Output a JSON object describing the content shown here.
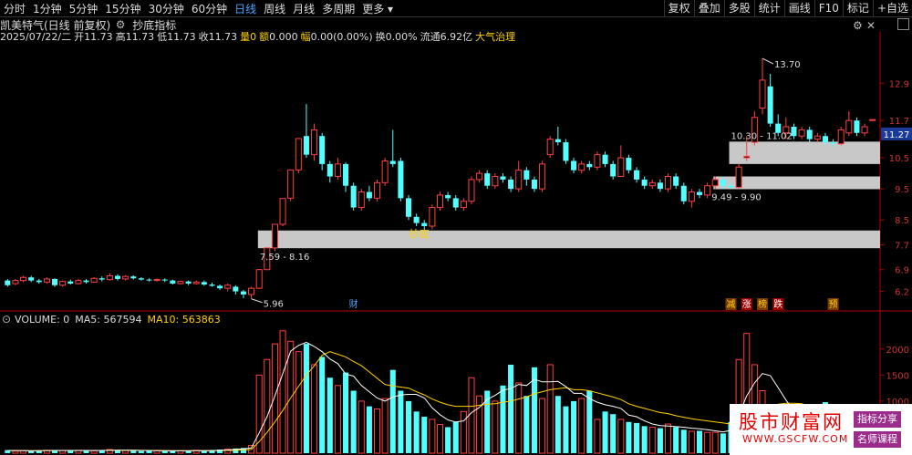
{
  "toolbar": {
    "tabs": [
      "分时",
      "1分钟",
      "5分钟",
      "15分钟",
      "30分钟",
      "60分钟",
      "日线",
      "周线",
      "月线",
      "多周期",
      "更多"
    ],
    "active_tab": "日线",
    "right_buttons": [
      "复权",
      "叠加",
      "多股",
      "统计",
      "画线",
      "F10",
      "标记",
      "+自选"
    ],
    "more_label": "更多"
  },
  "header": {
    "stock_name": "凯美特气(日线 前复权)",
    "indicator_name": "抄底指标"
  },
  "info": {
    "date": "2025/07/22/二",
    "open_label": "开",
    "open": "11.73",
    "high_label": "高",
    "high": "11.73",
    "low_label": "低",
    "low": "11.73",
    "close_label": "收",
    "close": "11.73",
    "vol_label": "量",
    "vol": "0",
    "amount_label": "额",
    "amount": "0.000",
    "range_label": "幅",
    "range": "0.00(0.00%)",
    "turnover_label": "换",
    "turnover": "0.00%",
    "float_label": "流通",
    "float": "6.92亿",
    "concept": "大气治理"
  },
  "volume_header": {
    "vol": "VOLUME: 0",
    "ma5": "MA5: 567594",
    "ma10": "MA10: 563863"
  },
  "colors": {
    "up": "#ff4040",
    "down": "#54ffff",
    "ma5": "#ffffff",
    "ma10": "#ffd200",
    "band": "#c8c8c8",
    "axis": "#b40000"
  },
  "chart_data": [
    {
      "type": "candlestick",
      "price_axis_ticks": [
        "12.9",
        "11.7",
        "10.5",
        "9.5",
        "8.5",
        "7.7",
        "6.9",
        "6.2"
      ],
      "ylim": [
        5.6,
        14.2
      ],
      "last_price_tag": "11.27",
      "annotations": {
        "high_marker": "13.70",
        "low_marker": "5.96",
        "bands": [
          {
            "label": "7.59 - 8.16",
            "low": 7.59,
            "high": 8.16
          },
          {
            "label": "9.49 - 9.90",
            "low": 9.49,
            "high": 9.9
          },
          {
            "label": "10.30 - 11.02",
            "low": 10.3,
            "high": 11.02
          }
        ],
        "signal_text": "抄底",
        "markers": [
          "财",
          "减",
          "涨",
          "榜",
          "跌",
          "预"
        ]
      },
      "candles": [
        {
          "o": 6.55,
          "c": 6.4,
          "h": 6.6,
          "l": 6.35
        },
        {
          "o": 6.45,
          "c": 6.55,
          "h": 6.6,
          "l": 6.4
        },
        {
          "o": 6.55,
          "c": 6.65,
          "h": 6.7,
          "l": 6.5
        },
        {
          "o": 6.65,
          "c": 6.55,
          "h": 6.7,
          "l": 6.5
        },
        {
          "o": 6.55,
          "c": 6.5,
          "h": 6.6,
          "l": 6.45
        },
        {
          "o": 6.5,
          "c": 6.6,
          "h": 6.65,
          "l": 6.45
        },
        {
          "o": 6.6,
          "c": 6.4,
          "h": 6.62,
          "l": 6.35
        },
        {
          "o": 6.4,
          "c": 6.52,
          "h": 6.55,
          "l": 6.35
        },
        {
          "o": 6.52,
          "c": 6.45,
          "h": 6.58,
          "l": 6.42
        },
        {
          "o": 6.45,
          "c": 6.55,
          "h": 6.6,
          "l": 6.42
        },
        {
          "o": 6.55,
          "c": 6.5,
          "h": 6.6,
          "l": 6.45
        },
        {
          "o": 6.5,
          "c": 6.62,
          "h": 6.66,
          "l": 6.48
        },
        {
          "o": 6.62,
          "c": 6.58,
          "h": 6.68,
          "l": 6.52
        },
        {
          "o": 6.58,
          "c": 6.7,
          "h": 6.78,
          "l": 6.55
        },
        {
          "o": 6.7,
          "c": 6.6,
          "h": 6.75,
          "l": 6.55
        },
        {
          "o": 6.6,
          "c": 6.68,
          "h": 6.72,
          "l": 6.55
        },
        {
          "o": 6.68,
          "c": 6.62,
          "h": 6.72,
          "l": 6.58
        },
        {
          "o": 6.62,
          "c": 6.58,
          "h": 6.66,
          "l": 6.55
        },
        {
          "o": 6.58,
          "c": 6.56,
          "h": 6.62,
          "l": 6.52
        },
        {
          "o": 6.56,
          "c": 6.58,
          "h": 6.62,
          "l": 6.52
        },
        {
          "o": 6.58,
          "c": 6.55,
          "h": 6.62,
          "l": 6.5
        },
        {
          "o": 6.55,
          "c": 6.45,
          "h": 6.58,
          "l": 6.42
        },
        {
          "o": 6.45,
          "c": 6.52,
          "h": 6.55,
          "l": 6.42
        },
        {
          "o": 6.52,
          "c": 6.45,
          "h": 6.55,
          "l": 6.4
        },
        {
          "o": 6.45,
          "c": 6.5,
          "h": 6.55,
          "l": 6.42
        },
        {
          "o": 6.5,
          "c": 6.42,
          "h": 6.55,
          "l": 6.38
        },
        {
          "o": 6.42,
          "c": 6.38,
          "h": 6.48,
          "l": 6.35
        },
        {
          "o": 6.38,
          "c": 6.3,
          "h": 6.42,
          "l": 6.25
        },
        {
          "o": 6.3,
          "c": 6.4,
          "h": 6.45,
          "l": 6.2
        },
        {
          "o": 6.35,
          "c": 6.2,
          "h": 6.4,
          "l": 6.1
        },
        {
          "o": 6.2,
          "c": 6.1,
          "h": 6.25,
          "l": 5.98
        },
        {
          "o": 6.1,
          "c": 6.3,
          "h": 6.35,
          "l": 5.96
        },
        {
          "o": 6.3,
          "c": 6.9,
          "h": 6.92,
          "l": 6.28
        },
        {
          "o": 6.9,
          "c": 7.6,
          "h": 7.6,
          "l": 6.9
        },
        {
          "o": 7.6,
          "c": 8.36,
          "h": 8.36,
          "l": 7.5
        },
        {
          "o": 8.36,
          "c": 9.19,
          "h": 9.19,
          "l": 8.3
        },
        {
          "o": 9.2,
          "c": 10.11,
          "h": 10.11,
          "l": 9.1
        },
        {
          "o": 10.11,
          "c": 11.12,
          "h": 11.12,
          "l": 10.0
        },
        {
          "o": 11.2,
          "c": 10.6,
          "h": 12.23,
          "l": 10.5
        },
        {
          "o": 10.6,
          "c": 11.4,
          "h": 11.6,
          "l": 10.4
        },
        {
          "o": 11.2,
          "c": 10.3,
          "h": 11.3,
          "l": 10.1
        },
        {
          "o": 10.3,
          "c": 9.9,
          "h": 10.4,
          "l": 9.7
        },
        {
          "o": 9.9,
          "c": 10.3,
          "h": 10.5,
          "l": 9.8
        },
        {
          "o": 10.3,
          "c": 9.6,
          "h": 10.35,
          "l": 9.4
        },
        {
          "o": 9.6,
          "c": 8.9,
          "h": 9.7,
          "l": 8.8
        },
        {
          "o": 8.9,
          "c": 9.4,
          "h": 9.5,
          "l": 8.8
        },
        {
          "o": 9.4,
          "c": 9.2,
          "h": 9.6,
          "l": 9.1
        },
        {
          "o": 9.2,
          "c": 9.7,
          "h": 9.8,
          "l": 9.1
        },
        {
          "o": 9.7,
          "c": 10.4,
          "h": 10.5,
          "l": 9.6
        },
        {
          "o": 10.4,
          "c": 10.3,
          "h": 11.4,
          "l": 10.2
        },
        {
          "o": 10.4,
          "c": 9.2,
          "h": 10.5,
          "l": 9.1
        },
        {
          "o": 9.2,
          "c": 8.6,
          "h": 9.3,
          "l": 8.5
        },
        {
          "o": 8.6,
          "c": 8.4,
          "h": 8.7,
          "l": 8.3
        },
        {
          "o": 8.4,
          "c": 8.3,
          "h": 8.5,
          "l": 8.2
        },
        {
          "o": 8.3,
          "c": 8.9,
          "h": 9.0,
          "l": 8.2
        },
        {
          "o": 8.9,
          "c": 9.3,
          "h": 9.4,
          "l": 8.8
        },
        {
          "o": 9.3,
          "c": 9.2,
          "h": 9.4,
          "l": 9.1
        },
        {
          "o": 9.2,
          "c": 8.9,
          "h": 9.3,
          "l": 8.8
        },
        {
          "o": 8.9,
          "c": 9.1,
          "h": 9.2,
          "l": 8.8
        },
        {
          "o": 9.1,
          "c": 9.8,
          "h": 9.9,
          "l": 9.0
        },
        {
          "o": 9.8,
          "c": 10.0,
          "h": 10.1,
          "l": 9.7
        },
        {
          "o": 10.0,
          "c": 9.6,
          "h": 10.1,
          "l": 9.5
        },
        {
          "o": 9.6,
          "c": 9.9,
          "h": 10.0,
          "l": 9.5
        },
        {
          "o": 9.9,
          "c": 9.8,
          "h": 10.0,
          "l": 9.7
        },
        {
          "o": 9.8,
          "c": 9.5,
          "h": 9.9,
          "l": 9.4
        },
        {
          "o": 9.5,
          "c": 10.1,
          "h": 10.4,
          "l": 9.4
        },
        {
          "o": 10.1,
          "c": 9.8,
          "h": 10.2,
          "l": 9.6
        },
        {
          "o": 9.8,
          "c": 9.5,
          "h": 9.9,
          "l": 9.4
        },
        {
          "o": 9.5,
          "c": 10.3,
          "h": 10.4,
          "l": 9.4
        },
        {
          "o": 10.6,
          "c": 11.1,
          "h": 11.2,
          "l": 10.5
        },
        {
          "o": 11.1,
          "c": 11.0,
          "h": 11.5,
          "l": 10.9
        },
        {
          "o": 11.0,
          "c": 10.4,
          "h": 11.1,
          "l": 10.3
        },
        {
          "o": 10.4,
          "c": 10.1,
          "h": 10.5,
          "l": 10.0
        },
        {
          "o": 10.1,
          "c": 10.3,
          "h": 10.4,
          "l": 10.0
        },
        {
          "o": 10.3,
          "c": 10.2,
          "h": 10.4,
          "l": 10.1
        },
        {
          "o": 10.2,
          "c": 10.6,
          "h": 10.7,
          "l": 10.1
        },
        {
          "o": 10.6,
          "c": 10.3,
          "h": 10.7,
          "l": 10.2
        },
        {
          "o": 10.3,
          "c": 9.9,
          "h": 10.4,
          "l": 9.8
        },
        {
          "o": 9.9,
          "c": 10.5,
          "h": 10.9,
          "l": 9.9
        },
        {
          "o": 10.5,
          "c": 10.1,
          "h": 10.6,
          "l": 10.0
        },
        {
          "o": 10.1,
          "c": 9.8,
          "h": 10.2,
          "l": 9.7
        },
        {
          "o": 9.8,
          "c": 9.6,
          "h": 9.9,
          "l": 9.5
        },
        {
          "o": 9.6,
          "c": 9.7,
          "h": 9.8,
          "l": 9.5
        },
        {
          "o": 9.7,
          "c": 9.5,
          "h": 9.8,
          "l": 9.4
        },
        {
          "o": 9.5,
          "c": 9.9,
          "h": 10.0,
          "l": 9.4
        },
        {
          "o": 9.9,
          "c": 9.6,
          "h": 10.0,
          "l": 9.5
        },
        {
          "o": 9.6,
          "c": 9.1,
          "h": 9.7,
          "l": 9.0
        },
        {
          "o": 9.1,
          "c": 9.4,
          "h": 9.5,
          "l": 8.9
        },
        {
          "o": 9.4,
          "c": 9.3,
          "h": 9.5,
          "l": 9.2
        },
        {
          "o": 9.3,
          "c": 9.6,
          "h": 9.7,
          "l": 9.2
        },
        {
          "o": 9.6,
          "c": 9.8,
          "h": 9.9,
          "l": 9.5
        },
        {
          "o": 9.8,
          "c": 9.6,
          "h": 9.9,
          "l": 9.49
        },
        {
          "o": 9.6,
          "c": 9.55,
          "h": 9.7,
          "l": 9.49
        },
        {
          "o": 9.55,
          "c": 10.2,
          "h": 10.3,
          "l": 9.5
        },
        {
          "o": 10.5,
          "c": 10.55,
          "h": 11.2,
          "l": 10.4
        },
        {
          "o": 11.0,
          "c": 11.8,
          "h": 12.0,
          "l": 10.9
        },
        {
          "o": 12.1,
          "c": 13.0,
          "h": 13.7,
          "l": 11.9
        },
        {
          "o": 12.8,
          "c": 11.6,
          "h": 13.2,
          "l": 11.5
        },
        {
          "o": 11.6,
          "c": 11.3,
          "h": 11.9,
          "l": 11.2
        },
        {
          "o": 11.3,
          "c": 11.5,
          "h": 11.8,
          "l": 11.1
        },
        {
          "o": 11.5,
          "c": 11.2,
          "h": 11.6,
          "l": 11.1
        },
        {
          "o": 11.2,
          "c": 11.4,
          "h": 11.5,
          "l": 11.1
        },
        {
          "o": 11.4,
          "c": 11.1,
          "h": 11.5,
          "l": 11.0
        },
        {
          "o": 11.1,
          "c": 11.2,
          "h": 11.3,
          "l": 11.0
        },
        {
          "o": 11.2,
          "c": 11.0,
          "h": 11.3,
          "l": 10.9
        },
        {
          "o": 11.0,
          "c": 10.95,
          "h": 11.1,
          "l": 10.85
        },
        {
          "o": 10.95,
          "c": 11.4,
          "h": 11.5,
          "l": 10.9
        },
        {
          "o": 11.3,
          "c": 11.7,
          "h": 12.0,
          "l": 11.2
        },
        {
          "o": 11.7,
          "c": 11.3,
          "h": 11.8,
          "l": 11.2
        },
        {
          "o": 11.3,
          "c": 11.5,
          "h": 11.6,
          "l": 11.2
        },
        {
          "o": 11.73,
          "c": 11.73,
          "h": 11.73,
          "l": 11.73
        }
      ]
    },
    {
      "type": "bar",
      "title": "VOLUME",
      "axis_ticks": [
        "2000",
        "1500",
        "1000"
      ],
      "ylim": [
        0,
        2400
      ],
      "values": [
        60,
        40,
        50,
        45,
        40,
        55,
        60,
        50,
        45,
        55,
        50,
        45,
        60,
        70,
        55,
        50,
        45,
        40,
        50,
        45,
        40,
        50,
        45,
        40,
        55,
        50,
        60,
        70,
        80,
        90,
        100,
        150,
        1500,
        1800,
        2100,
        2350,
        2150,
        1950,
        2100,
        1700,
        1850,
        1450,
        1300,
        1550,
        1200,
        1000,
        900,
        850,
        1050,
        1600,
        1200,
        1000,
        800,
        700,
        650,
        550,
        500,
        600,
        800,
        1450,
        1100,
        1200,
        1000,
        1300,
        1700,
        1350,
        1100,
        1650,
        1050,
        1700,
        1100,
        900,
        1000,
        1050,
        1200,
        650,
        800,
        750,
        650,
        600,
        580,
        520,
        500,
        480,
        560,
        500,
        450,
        420,
        430,
        400,
        400,
        380,
        600,
        1800,
        2300,
        1700,
        1200,
        600,
        500,
        350,
        450,
        250,
        220,
        300,
        980,
        500,
        400,
        350,
        0
      ],
      "ma5": [
        50,
        50,
        48,
        46,
        47,
        50,
        52,
        53,
        53,
        53,
        52,
        52,
        53,
        56,
        58,
        58,
        56,
        52,
        50,
        48,
        46,
        46,
        46,
        46,
        47,
        47,
        50,
        55,
        62,
        72,
        82,
        100,
        390,
        700,
        1100,
        1530,
        1960,
        2070,
        2130,
        2050,
        1950,
        1810,
        1720,
        1520,
        1480,
        1300,
        1180,
        1060,
        1000,
        1080,
        1120,
        1130,
        1130,
        1060,
        870,
        740,
        640,
        600,
        620,
        780,
        880,
        1030,
        1110,
        1210,
        1240,
        1320,
        1300,
        1420,
        1370,
        1370,
        1380,
        1280,
        1150,
        1150,
        1050,
        980,
        930,
        900,
        860,
        730,
        700,
        620,
        560,
        530,
        520,
        510,
        500,
        480,
        470,
        450,
        430,
        410,
        440,
        730,
        1100,
        1350,
        1530,
        1490,
        1260,
        1020,
        800,
        520,
        380,
        300,
        440,
        460,
        460,
        460,
        450
      ],
      "ma10": [
        50,
        50,
        50,
        48,
        48,
        49,
        50,
        51,
        51,
        51,
        51,
        51,
        52,
        53,
        54,
        55,
        55,
        54,
        53,
        52,
        50,
        49,
        48,
        47,
        47,
        47,
        48,
        50,
        53,
        57,
        62,
        72,
        220,
        400,
        600,
        820,
        1060,
        1280,
        1500,
        1680,
        1880,
        1950,
        1900,
        1850,
        1760,
        1680,
        1560,
        1440,
        1320,
        1290,
        1270,
        1250,
        1180,
        1120,
        1040,
        980,
        930,
        900,
        900,
        900,
        920,
        940,
        950,
        980,
        1000,
        1040,
        1080,
        1140,
        1180,
        1220,
        1240,
        1260,
        1220,
        1220,
        1200,
        1160,
        1120,
        1080,
        1030,
        950,
        900,
        860,
        820,
        780,
        760,
        720,
        690,
        660,
        640,
        620,
        600,
        580,
        560,
        570,
        600,
        650,
        780,
        880,
        940,
        960,
        960,
        950,
        900,
        820,
        760,
        720,
        680,
        640,
        600
      ]
    }
  ],
  "watermark": {
    "title": "股市财富网",
    "url": "WWW.GSCFW.COM",
    "badge1": "指标分享",
    "badge2": "名师课程"
  }
}
